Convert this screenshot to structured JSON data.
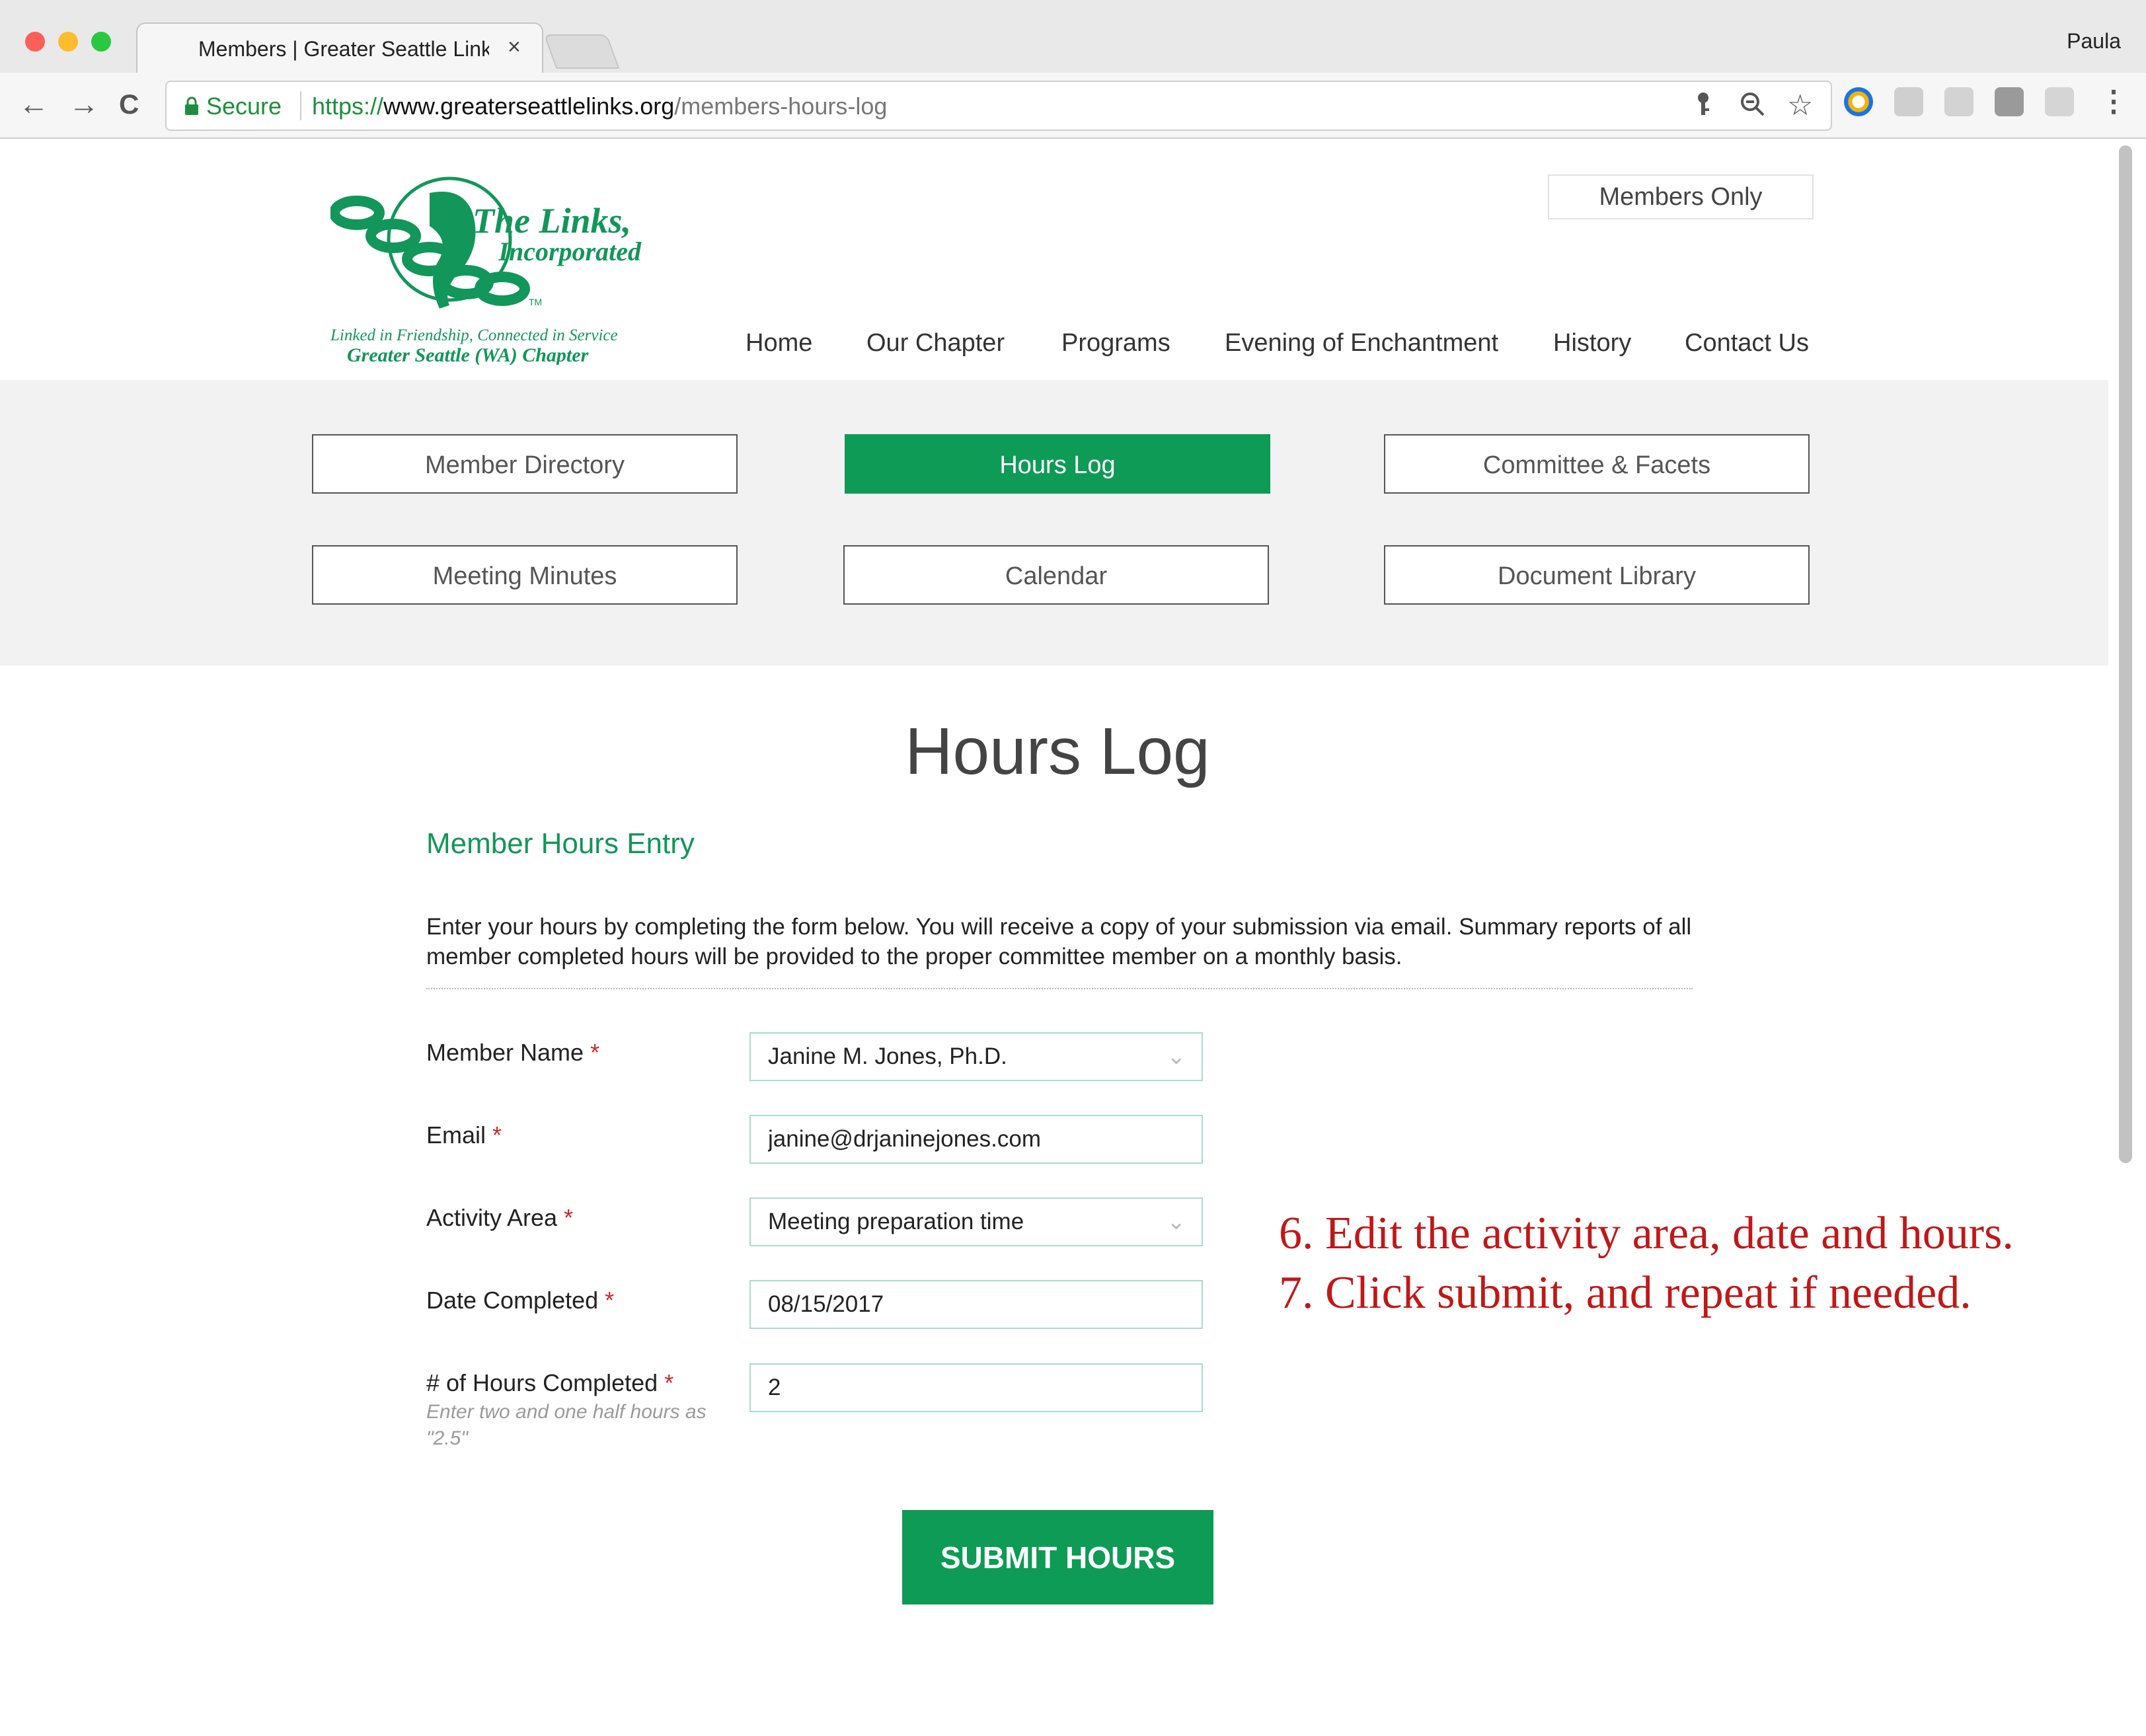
{
  "browser": {
    "tab_title": "Members | Greater Seattle Links",
    "tab_close": "×",
    "user_name": "Paula",
    "secure_label": "Secure",
    "url_protocol": "https://",
    "url_host": "www.greaterseattlelinks.org",
    "url_path": "/members-hours-log",
    "back": "←",
    "forward": "→",
    "reload": "C",
    "key_icon": "key-icon",
    "zoom_icon": "magnifier-minus-icon",
    "star_icon": "star-icon"
  },
  "logo": {
    "org_name_line1": "The Links,",
    "org_name_line2": "Incorporated",
    "tm": "TM",
    "tagline": "Linked in Friendship, Connected in Service",
    "chapter": "Greater Seattle (WA) Chapter",
    "color": "#12965a"
  },
  "header": {
    "members_only": "Members Only",
    "nav": [
      "Home",
      "Our Chapter",
      "Programs",
      "Evening of Enchantment",
      "History",
      "Contact Us"
    ]
  },
  "subnav": {
    "items": [
      {
        "label": "Member Directory",
        "active": false
      },
      {
        "label": "Hours Log",
        "active": true
      },
      {
        "label": "Committee & Facets",
        "active": false
      },
      {
        "label": "Meeting Minutes",
        "active": false
      },
      {
        "label": "Calendar",
        "active": false
      },
      {
        "label": "Document Library",
        "active": false
      }
    ]
  },
  "main": {
    "title": "Hours Log",
    "section_title": "Member Hours Entry",
    "intro": "Enter your hours by completing the form below.  You will receive a copy of your submission via email. Summary reports of all member completed hours will be provided to the proper committee member on a monthly basis.",
    "required_marker": "*",
    "form": {
      "member_name": {
        "label": "Member Name",
        "value": "Janine M. Jones, Ph.D."
      },
      "email": {
        "label": "Email",
        "value": "janine@drjaninejones.com"
      },
      "activity_area": {
        "label": "Activity Area",
        "value": "Meeting preparation time"
      },
      "date_completed": {
        "label": "Date Completed",
        "value": "08/15/2017"
      },
      "hours_completed": {
        "label": "# of Hours Completed",
        "hint": "Enter two and one half hours as \"2.5\"",
        "value": "2"
      }
    },
    "submit_label": "SUBMIT HOURS"
  },
  "annotation": {
    "line1": "6. Edit the activity area, date and hours.",
    "line2": "7. Click submit, and repeat if needed."
  },
  "colors": {
    "brand_green": "#0e9b55",
    "annotation_red": "#c01818",
    "required_red": "#cc2a2a"
  }
}
